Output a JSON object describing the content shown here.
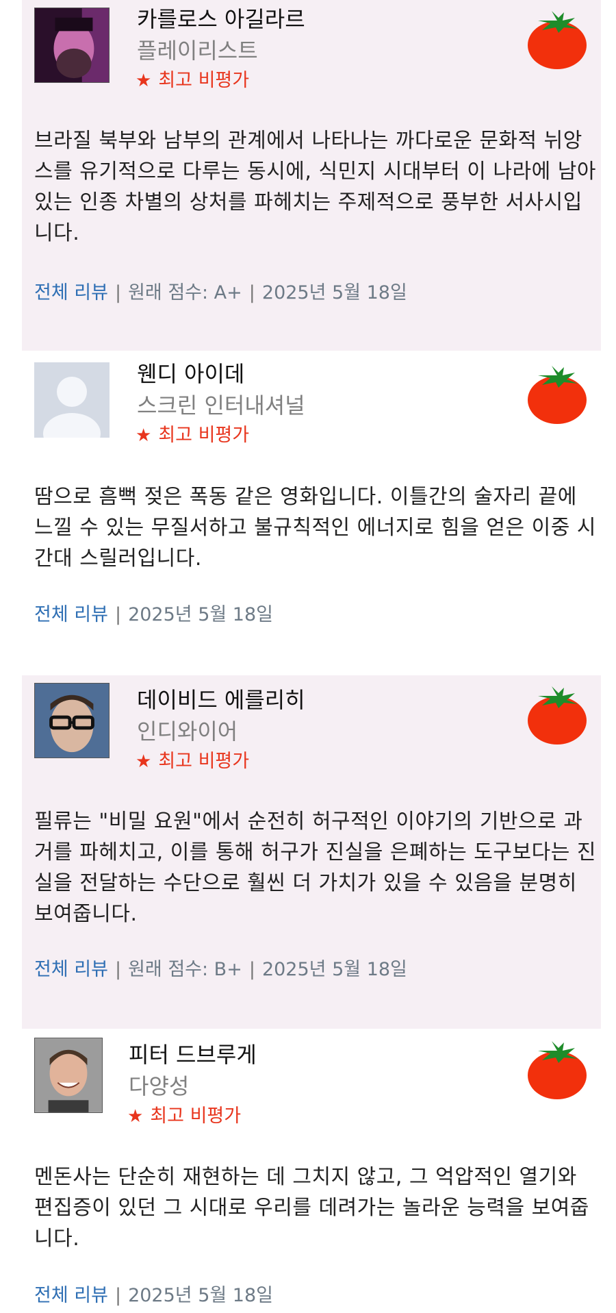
{
  "reviews": [
    {
      "critic": "카를로스 아길라르",
      "publication": "플레이리스트",
      "badge": "최고 비평가",
      "quote": "브라질 북부와 남부의 관계에서 나타나는 까다로운 문화적 뉘앙스를 유기적으로 다루는 동시에, 식민지 시대부터 이 나라에 남아 있는 인종 차별의 상처를 파헤치는 주제적으로 풍부한 서사시입니다.",
      "full_review": "전체 리뷰",
      "score": "원래 점수: A+",
      "date": "2025년 5월 18일"
    },
    {
      "critic": "웬디 아이데",
      "publication": "스크린 인터내셔널",
      "badge": "최고 비평가",
      "quote": "땀으로 흠뻑 젖은 폭동 같은 영화입니다. 이틀간의 술자리 끝에 느낄 수 있는 무질서하고 불규칙적인 에너지로 힘을 얻은 이중 시간대 스릴러입니다.",
      "full_review": "전체 리뷰",
      "date": "2025년 5월 18일"
    },
    {
      "critic": "데이비드 에를리히",
      "publication": "인디와이어",
      "badge": "최고 비평가",
      "quote": "필류는 \"비밀 요원\"에서 순전히 허구적인 이야기의 기반으로 과거를 파헤치고, 이를 통해 허구가 진실을 은폐하는 도구보다는 진실을 전달하는 수단으로 훨씬 더 가치가 있을 수 있음을 분명히 보여줍니다.",
      "full_review": "전체 리뷰",
      "score": "원래 점수: B+",
      "date": "2025년 5월 18일"
    },
    {
      "critic": "피터 드브루게",
      "publication": "다양성",
      "badge": "최고 비평가",
      "quote": "멘돈사는 단순히 재현하는 데 그치지 않고, 그 억압적인 열기와 편집증이 있던 그 시대로 우리를 데려가는 놀라운 능력을 보여줍니다.",
      "full_review": "전체 리뷰",
      "date": "2025년 5월 18일"
    }
  ],
  "colors": {
    "card_shaded": "#f6eff4",
    "accent_red": "#e8351d",
    "link_blue": "#2f6fb4",
    "meta_gray": "#6d7a86"
  },
  "icons": {
    "rating": "fresh-tomato-icon",
    "badge": "star-icon"
  }
}
